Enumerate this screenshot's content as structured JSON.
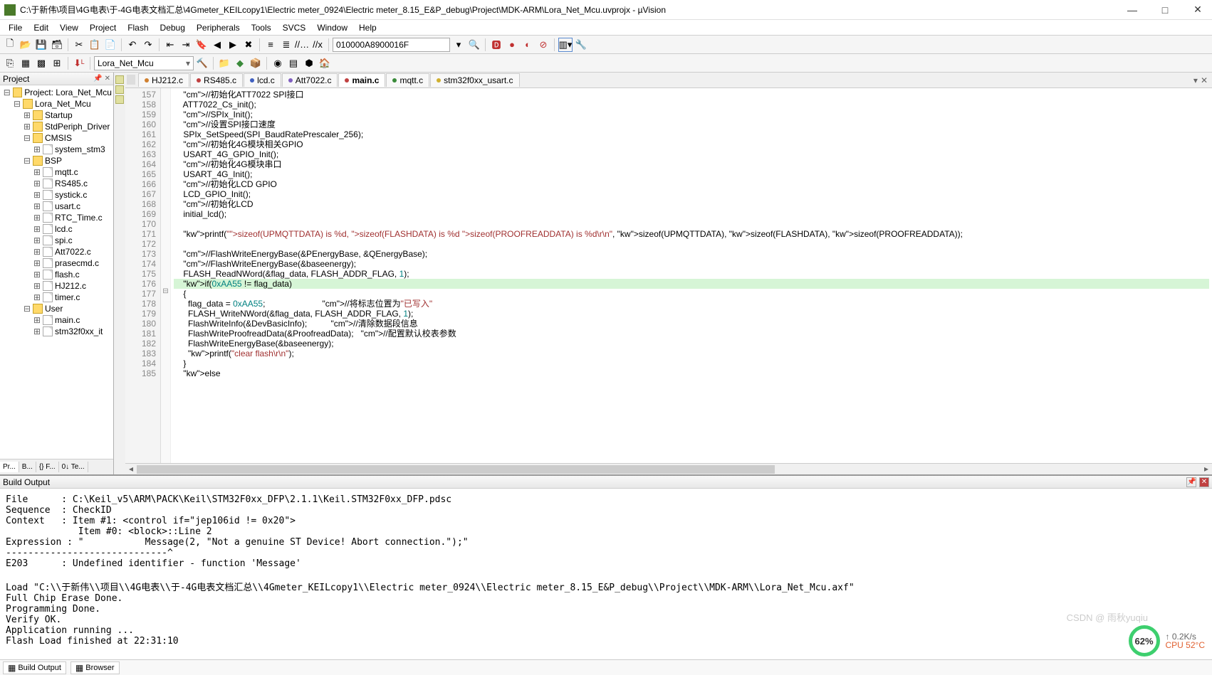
{
  "title": "C:\\于新伟\\项目\\4G电表\\于-4G电表文档汇总\\4Gmeter_KEILcopy1\\Electric meter_0924\\Electric meter_8.15_E&P_debug\\Project\\MDK-ARM\\Lora_Net_Mcu.uvprojx - µVision",
  "menus": [
    "File",
    "Edit",
    "View",
    "Project",
    "Flash",
    "Debug",
    "Peripherals",
    "Tools",
    "SVCS",
    "Window",
    "Help"
  ],
  "toolbar": {
    "search_value": "010000A8900016F",
    "target_combo": "Lora_Net_Mcu"
  },
  "project": {
    "title": "Project",
    "root": "Project: Lora_Net_Mcu",
    "target": "Lora_Net_Mcu",
    "groups": [
      {
        "name": "Startup",
        "files": []
      },
      {
        "name": "StdPeriph_Driver",
        "files": []
      },
      {
        "name": "CMSIS",
        "files": [
          "system_stm3"
        ]
      },
      {
        "name": "BSP",
        "files": [
          "mqtt.c",
          "RS485.c",
          "systick.c",
          "usart.c",
          "RTC_Time.c",
          "lcd.c",
          "spi.c",
          "Att7022.c",
          "prasecmd.c",
          "flash.c",
          "HJ212.c",
          "timer.c"
        ]
      },
      {
        "name": "User",
        "files": [
          "main.c",
          "stm32f0xx_it"
        ]
      }
    ],
    "bottom_tabs": [
      "Pr...",
      "B...",
      "{} F...",
      "0↓ Te..."
    ]
  },
  "editor": {
    "tabs": [
      {
        "label": "HJ212.c",
        "color": "orange"
      },
      {
        "label": "RS485.c",
        "color": "red"
      },
      {
        "label": "lcd.c",
        "color": "blue"
      },
      {
        "label": "Att7022.c",
        "color": "purple"
      },
      {
        "label": "main.c",
        "color": "red",
        "active": true
      },
      {
        "label": "mqtt.c",
        "color": "green"
      },
      {
        "label": "stm32f0xx_usart.c",
        "color": "yellow"
      }
    ],
    "first_line": 157,
    "lines": [
      "    //初始化ATT7022 SPI接口",
      "    ATT7022_Cs_init();",
      "    //SPIx_Init();",
      "    //设置SPI接口速度",
      "    SPIx_SetSpeed(SPI_BaudRatePrescaler_256);",
      "    //初始化4G模块相关GPIO",
      "    USART_4G_GPIO_Init();",
      "    //初始化4G模块串口",
      "    USART_4G_Init();",
      "    //初始化LCD GPIO",
      "    LCD_GPIO_Init();",
      "    //初始化LCD",
      "    initial_lcd();",
      "",
      "    printf(\"sizeof(UPMQTTDATA) is %d, sizeof(FLASHDATA) is %d sizeof(PROOFREADDATA) is %d\\r\\n\", sizeof(UPMQTTDATA), sizeof(FLASHDATA), sizeof(PROOFREADDATA));",
      "",
      "    //FlashWriteEnergyBase(&PEnergyBase, &QEnergyBase);",
      "    //FlashWriteEnergyBase(&baseenergy);",
      "    FLASH_ReadNWord(&flag_data, FLASH_ADDR_FLAG, 1);",
      "    if(0xAA55 != flag_data)",
      "    {",
      "      flag_data = 0xAA55;                        //将标志位置为\"已写入\"",
      "      FLASH_WriteNWord(&flag_data, FLASH_ADDR_FLAG, 1);",
      "      FlashWriteInfo(&DevBasicInfo);          //清除数据段信息",
      "      FlashWriteProofreadData(&ProofreadData);   //配置默认校表参数",
      "      FlashWriteEnergyBase(&baseenergy);",
      "      printf(\"clear flash\\r\\n\");",
      "    }",
      "    else"
    ],
    "highlight_line": 176
  },
  "build": {
    "title": "Build Output",
    "text": "File      : C:\\Keil_v5\\ARM\\PACK\\Keil\\STM32F0xx_DFP\\2.1.1\\Keil.STM32F0xx_DFP.pdsc\nSequence  : CheckID\nContext   : Item #1: <control if=\"jep106id != 0x20\">\n             Item #0: <block>::Line 2\nExpression : \"           Message(2, \"Not a genuine ST Device! Abort connection.\");\"\n-----------------------------^\nE203      : Undefined identifier - function 'Message'\n\nLoad \"C:\\\\于新伟\\\\项目\\\\4G电表\\\\于-4G电表文档汇总\\\\4Gmeter_KEILcopy1\\\\Electric meter_0924\\\\Electric meter_8.15_E&P_debug\\\\Project\\\\MDK-ARM\\\\Lora_Net_Mcu.axf\"\nFull Chip Erase Done.\nProgramming Done.\nVerify OK.\nApplication running ...\nFlash Load finished at 22:31:10\n"
  },
  "bottom_tabs": [
    "Build Output",
    "Browser"
  ],
  "widget": {
    "percent": "62%",
    "net": "0.2K/s",
    "cpu": "CPU 52°C"
  },
  "watermark": "CSDN @ 雨秋yuqiu"
}
